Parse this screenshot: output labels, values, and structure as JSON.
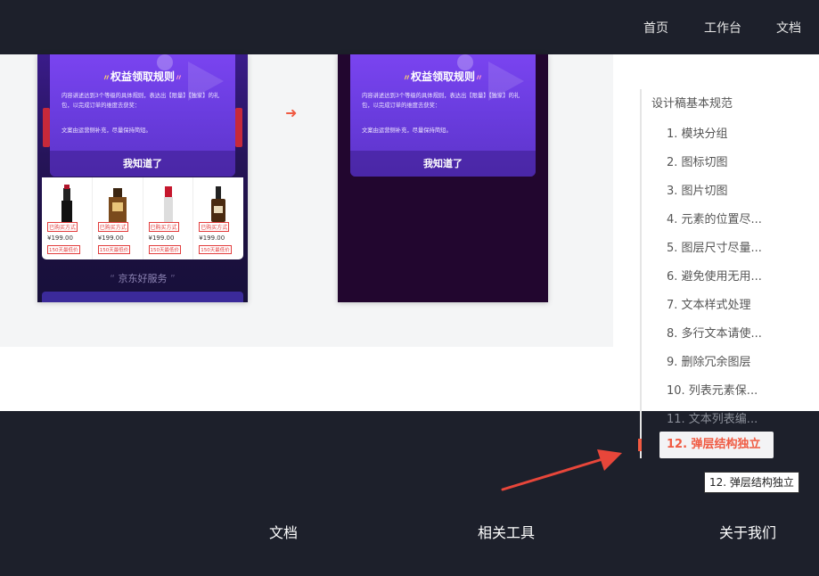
{
  "header": {
    "nav": [
      "首页",
      "工作台",
      "文档"
    ]
  },
  "preview": {
    "left_popup": {
      "title": "权益领取规则",
      "body": "内容讲述达到3个等级的具体规则，表达出【限量】【独家】的礼包，以完成订单的维度去获奖：",
      "note": "文案由运营侧补充，尽量保持简短。",
      "button": "我知道了"
    },
    "right_popup": {
      "title": "权益领取规则",
      "body": "内容讲述达到3个等级的具体规则，表达出【限量】【独家】的礼包，以完成订单的维度去获奖：",
      "note": "文案由运营侧补充，尽量保持简短。",
      "button": "我知道了"
    },
    "products": [
      {
        "tag": "已购买方式",
        "price": "¥199.00",
        "sub": "150天最低价"
      },
      {
        "tag": "已购买方式",
        "price": "¥199.00",
        "sub": "150天最低价"
      },
      {
        "tag": "已购买方式",
        "price": "¥199.00",
        "sub": "150天最低价"
      },
      {
        "tag": "已购买方式",
        "price": "¥199.00",
        "sub": "150天最低价"
      }
    ],
    "section_title": "京东好服务",
    "arrow": "➜"
  },
  "toc": {
    "heading": "设计稿基本规范",
    "items": [
      "1. 模块分组",
      "2. 图标切图",
      "3. 图片切图",
      "4. 元素的位置尽...",
      "5. 图层尺寸尽量...",
      "6. 避免使用无用...",
      "7. 文本样式处理",
      "8. 多行文本请使...",
      "9. 删除冗余图层",
      "10. 列表元素保...",
      "11. 文本列表编..."
    ],
    "active": "12. 弹层结构独立",
    "tooltip": "12. 弹层结构独立",
    "accent_color": "#f05a42"
  },
  "footer": {
    "links": [
      "文档",
      "相关工具",
      "关于我们"
    ]
  }
}
